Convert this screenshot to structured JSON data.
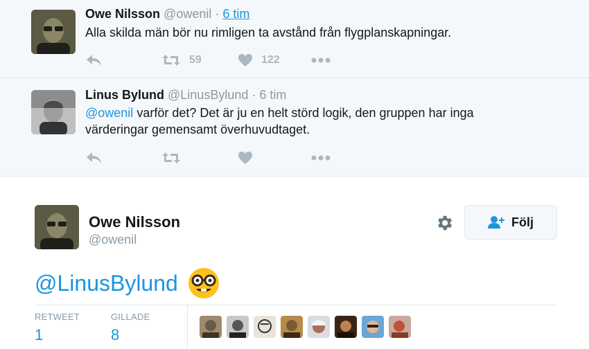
{
  "thread": [
    {
      "fullname": "Owe Nilsson",
      "username": "@owenil",
      "separator": "·",
      "time": "6 tim",
      "text": "Alla skilda män bör nu rimligen ta avstånd från flygplanskapningar.",
      "retweets": "59",
      "likes": "122"
    },
    {
      "fullname": "Linus Bylund",
      "username": "@LinusBylund",
      "separator": "·",
      "time": "6 tim",
      "mention": "@owenil",
      "text": " varför det? Det är ju en helt störd logik, den gruppen har inga värderingar gemensamt överhuvudtaget."
    }
  ],
  "main": {
    "fullname": "Owe Nilsson",
    "username": "@owenil",
    "follow_label": "Följ",
    "text": "@LinusBylund",
    "emoji": "nerd-face",
    "stats": {
      "retweet_label": "RETWEET",
      "retweet_value": "1",
      "like_label": "GILLADE",
      "like_value": "8"
    },
    "liker_count": 8
  },
  "colors": {
    "link": "#1b95e0",
    "muted": "#8899a6",
    "icon": "#aab8c2",
    "thread_bg": "#f5f8fa",
    "border": "#e1e8ed"
  },
  "icons": [
    "reply-icon",
    "retweet-icon",
    "heart-icon",
    "more-icon",
    "gear-icon",
    "follow-person-icon"
  ]
}
